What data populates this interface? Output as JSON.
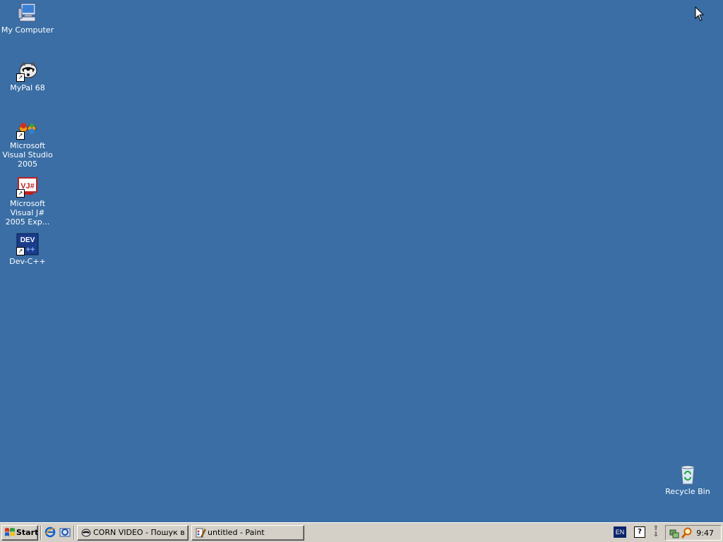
{
  "desktop": {
    "background": "#3a6ea5",
    "icons": [
      {
        "label": "My Computer",
        "icon": "computer-icon",
        "shortcut": false
      },
      {
        "label": "MyPal 68",
        "icon": "raccoon-icon",
        "shortcut": true
      },
      {
        "label": "Microsoft Visual Studio 2005",
        "icon": "visual-studio-icon",
        "shortcut": true
      },
      {
        "label": "Microsoft Visual J# 2005 Exp...",
        "icon": "vjsharp-icon",
        "shortcut": true
      },
      {
        "label": "Dev-C++",
        "icon": "devcpp-icon",
        "shortcut": true
      },
      {
        "label": "Recycle Bin",
        "icon": "recycle-bin-icon",
        "shortcut": false
      }
    ]
  },
  "taskbar": {
    "start_label": "Start",
    "quick_launch": [
      "internet-explorer-icon",
      "outlook-express-icon"
    ],
    "tasks": [
      {
        "label": "CORN VIDEO - Пошук в ...",
        "icon": "raccoon-icon",
        "active": false
      },
      {
        "label": "untitled - Paint",
        "icon": "paint-icon",
        "active": false
      }
    ],
    "language": "EN",
    "clock": "9:47"
  },
  "lang_text": "EN",
  "help_text": "?",
  "restore_text": "⇧\n⇩"
}
